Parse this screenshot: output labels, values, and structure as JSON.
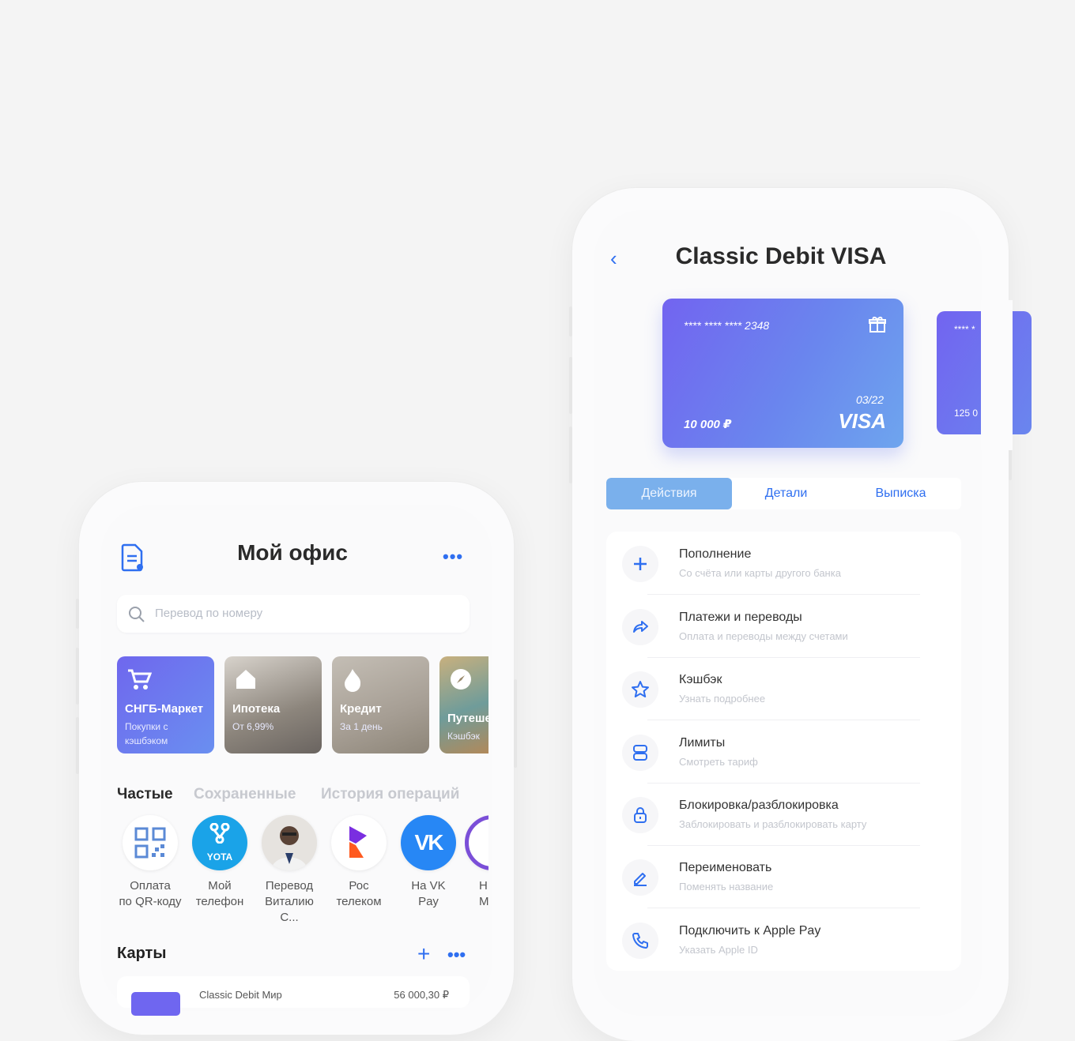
{
  "left_phone": {
    "title": "Мой офис",
    "more_label": "•••",
    "search_placeholder": "Перевод по номеру",
    "promos": [
      {
        "title": "СНГБ-Маркет",
        "subtitle": "Покупки с кэшбэком",
        "color": "#6f67ee"
      },
      {
        "title": "Ипотека",
        "subtitle": "От 6,99%",
        "color": "#8c857c"
      },
      {
        "title": "Кредит",
        "subtitle": "За 1 день",
        "color": "#a69e94"
      },
      {
        "title": "Путешествия",
        "subtitle": "Кэшбэк",
        "color": "#9a8a6d"
      }
    ],
    "tabs": [
      {
        "label": "Частые",
        "active": true
      },
      {
        "label": "Сохраненные",
        "active": false
      },
      {
        "label": "История операций",
        "active": false
      }
    ],
    "favorites": [
      {
        "label_line1": "Оплата",
        "label_line2": "по QR-коду",
        "icon": "qr-code-icon"
      },
      {
        "label_line1": "Мой",
        "label_line2": "телефон",
        "icon": "yota-logo-icon",
        "badge": "YOTA"
      },
      {
        "label_line1": "Перевод",
        "label_line2": "Виталию С...",
        "icon": "person-avatar"
      },
      {
        "label_line1": "Рос",
        "label_line2": "телеком",
        "icon": "rostelecom-logo-icon"
      },
      {
        "label_line1": "На VK",
        "label_line2": "Pay",
        "icon": "vk-logo-icon",
        "badge": "VK"
      },
      {
        "label_line1": "Н",
        "label_line2": "М",
        "icon": "viber-logo-icon"
      }
    ],
    "cards_section": {
      "title": "Карты",
      "add_label": "+",
      "more_label": "•••",
      "first_card_name": "Classic Debit Мир",
      "first_card_balance": "56 000,30 ₽"
    }
  },
  "right_phone": {
    "back_label": "‹",
    "title": "Classic Debit VISA",
    "card": {
      "number": "**** **** **** 2348",
      "expiry": "03/22",
      "balance": "10 000 ₽",
      "brand": "VISA"
    },
    "next_card": {
      "number": "**** *",
      "balance": "125 0"
    },
    "segments": [
      {
        "label": "Действия",
        "active": true
      },
      {
        "label": "Детали",
        "active": false
      },
      {
        "label": "Выписка",
        "active": false
      }
    ],
    "actions": [
      {
        "title": "Пополнение",
        "subtitle": "Со счёта или карты другого банка",
        "icon": "plus-icon"
      },
      {
        "title": "Платежи и переводы",
        "subtitle": "Оплата и переводы между счетами",
        "icon": "share-arrow-icon"
      },
      {
        "title": "Кэшбэк",
        "subtitle": "Узнать подробнее",
        "icon": "star-icon"
      },
      {
        "title": "Лимиты",
        "subtitle": "Смотреть тариф",
        "icon": "limits-icon"
      },
      {
        "title": "Блокировка/разблокировка",
        "subtitle": "Заблокировать и разблокировать карту",
        "icon": "lock-icon"
      },
      {
        "title": "Переименовать",
        "subtitle": "Поменять название",
        "icon": "pencil-icon"
      },
      {
        "title": "Подключить к Apple Pay",
        "subtitle": "Указать Apple ID",
        "icon": "phone-icon"
      }
    ]
  },
  "colors": {
    "accent": "#2f6ff0",
    "card_gradient_start": "#7264f0",
    "card_gradient_end": "#6ea5ee",
    "segment_active": "#7ab0ec"
  }
}
